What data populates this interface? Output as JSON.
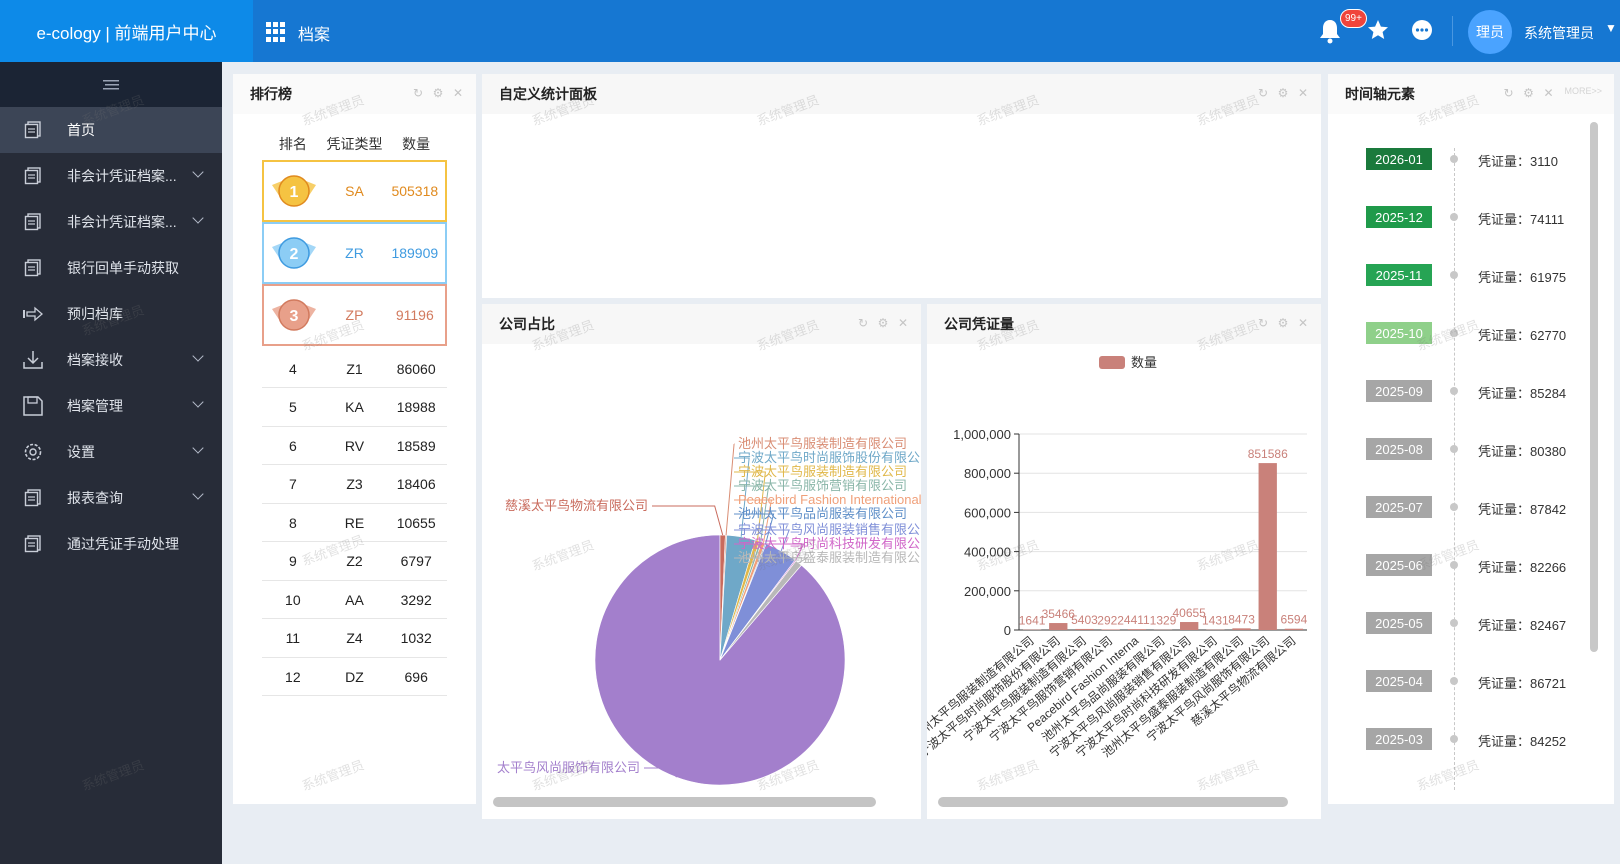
{
  "header": {
    "brand": "e-cology | 前端用户中心",
    "module": "档案",
    "badge": "99+",
    "avatar_text": "理员",
    "username": "系统管理员"
  },
  "sidebar": {
    "items": [
      {
        "label": "首页",
        "icon": "document-icon",
        "active": true,
        "expandable": false
      },
      {
        "label": "非会计凭证档案...",
        "icon": "document-icon",
        "expandable": true
      },
      {
        "label": "非会计凭证档案...",
        "icon": "document-icon",
        "expandable": true
      },
      {
        "label": "银行回单手动获取",
        "icon": "document-icon",
        "expandable": false
      },
      {
        "label": "预归档库",
        "icon": "arrow-right-icon",
        "expandable": false
      },
      {
        "label": "档案接收",
        "icon": "download-icon",
        "expandable": true
      },
      {
        "label": "档案管理",
        "icon": "save-icon",
        "expandable": true
      },
      {
        "label": "设置",
        "icon": "gear-icon",
        "expandable": true
      },
      {
        "label": "报表查询",
        "icon": "document-icon",
        "expandable": true
      },
      {
        "label": "通过凭证手动处理",
        "icon": "document-icon",
        "expandable": false
      }
    ]
  },
  "ranking": {
    "title": "排行榜",
    "columns": [
      "排名",
      "凭证类型",
      "数量"
    ],
    "top": [
      {
        "rank": "1",
        "type": "SA",
        "count": "505318",
        "color": "#f5c342",
        "text": "#e08a1e"
      },
      {
        "rank": "2",
        "type": "ZR",
        "count": "189909",
        "color": "#8ccdf5",
        "text": "#3f9be0"
      },
      {
        "rank": "3",
        "type": "ZP",
        "count": "91196",
        "color": "#e8a08a",
        "text": "#d27a5e"
      }
    ],
    "rows": [
      {
        "rank": "4",
        "type": "Z1",
        "count": "86060"
      },
      {
        "rank": "5",
        "type": "KA",
        "count": "18988"
      },
      {
        "rank": "6",
        "type": "RV",
        "count": "18589"
      },
      {
        "rank": "7",
        "type": "Z3",
        "count": "18406"
      },
      {
        "rank": "8",
        "type": "RE",
        "count": "10655"
      },
      {
        "rank": "9",
        "type": "Z2",
        "count": "6797"
      },
      {
        "rank": "10",
        "type": "AA",
        "count": "3292"
      },
      {
        "rank": "11",
        "type": "Z4",
        "count": "1032"
      },
      {
        "rank": "12",
        "type": "DZ",
        "count": "696"
      }
    ]
  },
  "custom_panel": {
    "title": "自定义统计面板"
  },
  "pie_panel": {
    "title": "公司占比"
  },
  "bar_panel": {
    "title": "公司凭证量"
  },
  "timeline": {
    "title": "时间轴元素",
    "more": "MORE>>",
    "label_prefix": "凭证量：",
    "items": [
      {
        "date": "2026-01",
        "count": "3110",
        "color": "#1a7a3c"
      },
      {
        "date": "2025-12",
        "count": "74111",
        "color": "#1f9a4a"
      },
      {
        "date": "2025-11",
        "count": "61975",
        "color": "#26a454"
      },
      {
        "date": "2025-10",
        "count": "62770",
        "color": "#8fd08a"
      },
      {
        "date": "2025-09",
        "count": "85284",
        "color": "#a6a6a6"
      },
      {
        "date": "2025-08",
        "count": "80380",
        "color": "#a6a6a6"
      },
      {
        "date": "2025-07",
        "count": "87842",
        "color": "#a6a6a6"
      },
      {
        "date": "2025-06",
        "count": "82266",
        "color": "#a6a6a6"
      },
      {
        "date": "2025-05",
        "count": "82467",
        "color": "#a6a6a6"
      },
      {
        "date": "2025-04",
        "count": "86721",
        "color": "#a6a6a6"
      },
      {
        "date": "2025-03",
        "count": "84252",
        "color": "#a6a6a6"
      }
    ]
  },
  "watermark": "系统管理员",
  "chart_data": [
    {
      "type": "pie",
      "slices": [
        {
          "label": "太平鸟风尚服饰有限公司",
          "value": 851586,
          "color": "#a37fcc"
        },
        {
          "label": "慈溪太平鸟物流有限公司",
          "value": 6594,
          "color": "#c96b5d"
        },
        {
          "label": "池州太平鸟服装制造有限公司",
          "value": 1641,
          "color": "#d98d74"
        },
        {
          "label": "宁波太平鸟时尚服饰股份有限公司",
          "value": 35466,
          "color": "#6fa8c8"
        },
        {
          "label": "宁波太平鸟服装制造有限公司",
          "value": 5403,
          "color": "#e0b84a"
        },
        {
          "label": "宁波太平鸟服饰营销有限公司",
          "value": 2922,
          "color": "#8ab6a8"
        },
        {
          "label": "Peacebird Fashion International",
          "value": 4411,
          "color": "#f0a07a"
        },
        {
          "label": "池州太平鸟品尚服装有限公司",
          "value": 1329,
          "color": "#5f8fc8"
        },
        {
          "label": "宁波太平鸟风尚服装销售有限公司",
          "value": 40655,
          "color": "#7f8fd8"
        },
        {
          "label": "宁波太平鸟时尚科技研发有限公司",
          "value": 1431,
          "color": "#d066c8"
        },
        {
          "label": "池州太平鸟盛泰服装制造有限公司",
          "value": 8473,
          "color": "#b8b8b8"
        }
      ]
    },
    {
      "type": "bar",
      "legend": "数量",
      "color": "#c9817a",
      "ylim": [
        0,
        1000000
      ],
      "yticks": [
        "0",
        "200,000",
        "400,000",
        "600,000",
        "800,000",
        "1,000,000"
      ],
      "categories": [
        "池州太平鸟服装制造有限公司",
        "宁波太平鸟时尚服饰股份有限公司",
        "宁波太平鸟服装制造有限公司",
        "宁波太平鸟服饰营销有限公司",
        "Peacebird Fashion Interna",
        "池州太平鸟品尚服装有限公司",
        "宁波太平鸟风尚服装销售有限公司",
        "宁波太平鸟时尚科技研发有限公司",
        "池州太平鸟盛泰服装制造有限公司",
        "宁波太平鸟风尚服饰有限公司",
        "慈溪太平鸟物流有限公司"
      ],
      "values": [
        1641,
        35466,
        5403,
        2922,
        4411,
        1329,
        40655,
        1431,
        8473,
        851586,
        6594
      ],
      "value_labels": [
        "1641",
        "35466",
        "5403",
        "2922",
        "4411",
        "1329",
        "40655",
        "1431",
        "8473",
        "851586",
        "6594"
      ]
    }
  ]
}
